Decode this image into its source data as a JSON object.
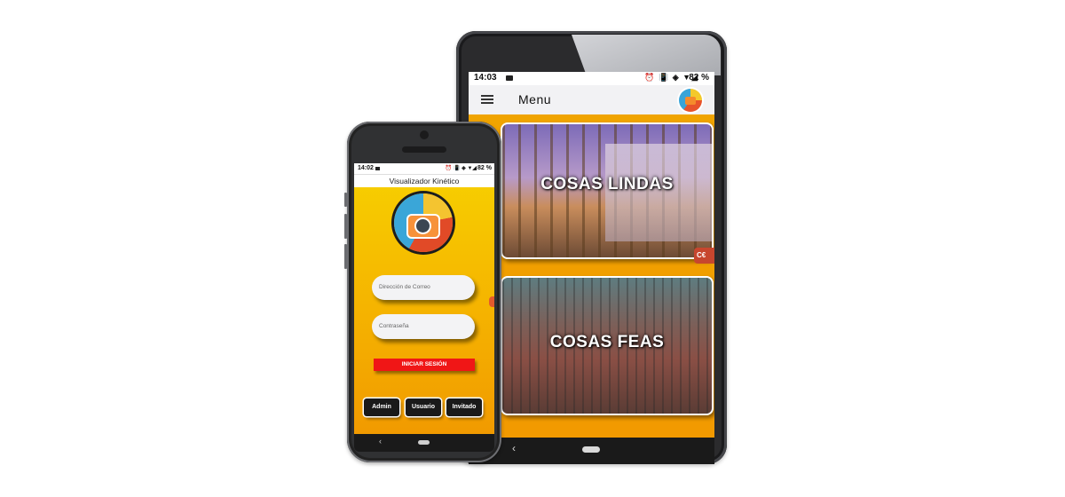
{
  "tablet": {
    "status_time": "14:03",
    "status_icons": "⏰ 📳 ◈ ▼◢",
    "battery": "82 %",
    "appbar_title": "Menu",
    "cards": [
      {
        "label": "COSAS LINDAS"
      },
      {
        "label": "COSAS FEAS"
      }
    ],
    "edge_chip": "C€",
    "nav_back": "‹"
  },
  "phone": {
    "status_time": "14:02",
    "status_icons": "⏰ 📳 ◈ ▼◢",
    "battery": "82 %",
    "appbar_title": "Visualizador Kinético",
    "email_placeholder": "Dirección de Correo",
    "password_placeholder": "Contraseña",
    "login_button": "INICIAR SESIÓN",
    "roles": [
      "Admin",
      "Usuario",
      "Invitado"
    ],
    "nav_back": "‹"
  },
  "icons": {
    "menu": "hamburger-icon",
    "app_logo": "camera-logo-icon",
    "camera_status": "video-camera-icon"
  },
  "colors": {
    "background_gradient_top": "#f7d100",
    "background_gradient_bottom": "#f19a00",
    "login_button": "#f01616",
    "role_buttons": "#1a1a1a"
  }
}
